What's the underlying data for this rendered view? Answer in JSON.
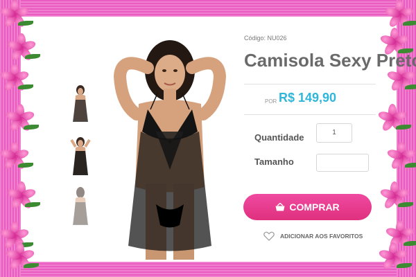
{
  "product": {
    "code_label": "Código: NU026",
    "title": "Camisola Sexy Preto",
    "price_prefix": "POR",
    "price": "R$ 149,90"
  },
  "form": {
    "quantity_label": "Quantidade",
    "quantity_value": "1",
    "size_label": "Tamanho",
    "size_value": ""
  },
  "actions": {
    "buy_label": "COMPRAR",
    "favorite_label": "ADICIONAR AOS FAVORITOS"
  },
  "colors": {
    "frame": "#e95cc0",
    "price": "#2fb6d9",
    "buy_button": "#e0307f"
  },
  "icons": {
    "buy": "basket-icon",
    "favorite": "heart-icon"
  }
}
